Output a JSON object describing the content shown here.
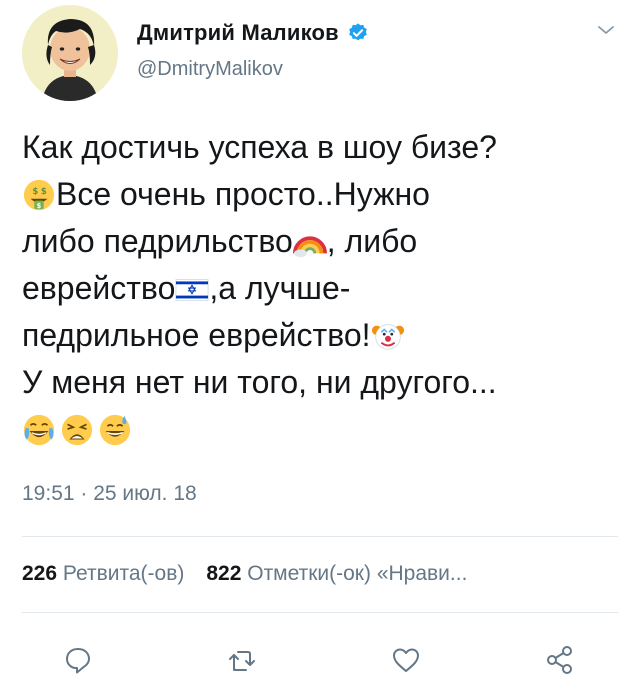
{
  "author": {
    "display_name": "Дмитрий Маликов",
    "handle": "@DmitryMalikov",
    "verified": true
  },
  "tweet": {
    "lines": [
      {
        "text": "Как достичь успеха в шоу бизе?",
        "emoji_after": null
      },
      {
        "emoji_before": "money-mouth-face-emoji",
        "text": "Все очень просто..Нужно"
      },
      {
        "text": "либо педрильство",
        "emoji_after": "rainbow-emoji",
        "text_after": ", либо"
      },
      {
        "text": "еврейство",
        "emoji_after": "israel-flag-emoji",
        "text_after": ",а лучше-"
      },
      {
        "text": "педрильное еврейство!",
        "emoji_after": "clown-face-emoji"
      },
      {
        "text": "У меня нет ни того, ни другого..."
      }
    ],
    "trailing_emojis": [
      "face-with-tears-of-joy-emoji",
      "weary-face-emoji",
      "grinning-sweat-emoji"
    ],
    "timestamp": "19:51 · 25 июл. 18"
  },
  "stats": {
    "retweets_count": "226",
    "retweets_label": "Ретвита(-ов)",
    "likes_count": "822",
    "likes_label": "Отметки(-ок) «Нрави..."
  },
  "actions": [
    "reply-icon",
    "retweet-icon",
    "like-icon",
    "share-icon"
  ],
  "colors": {
    "text": "#14171a",
    "secondary": "#657786",
    "verified_blue": "#1da1f2",
    "divider": "#e1e8ed"
  }
}
